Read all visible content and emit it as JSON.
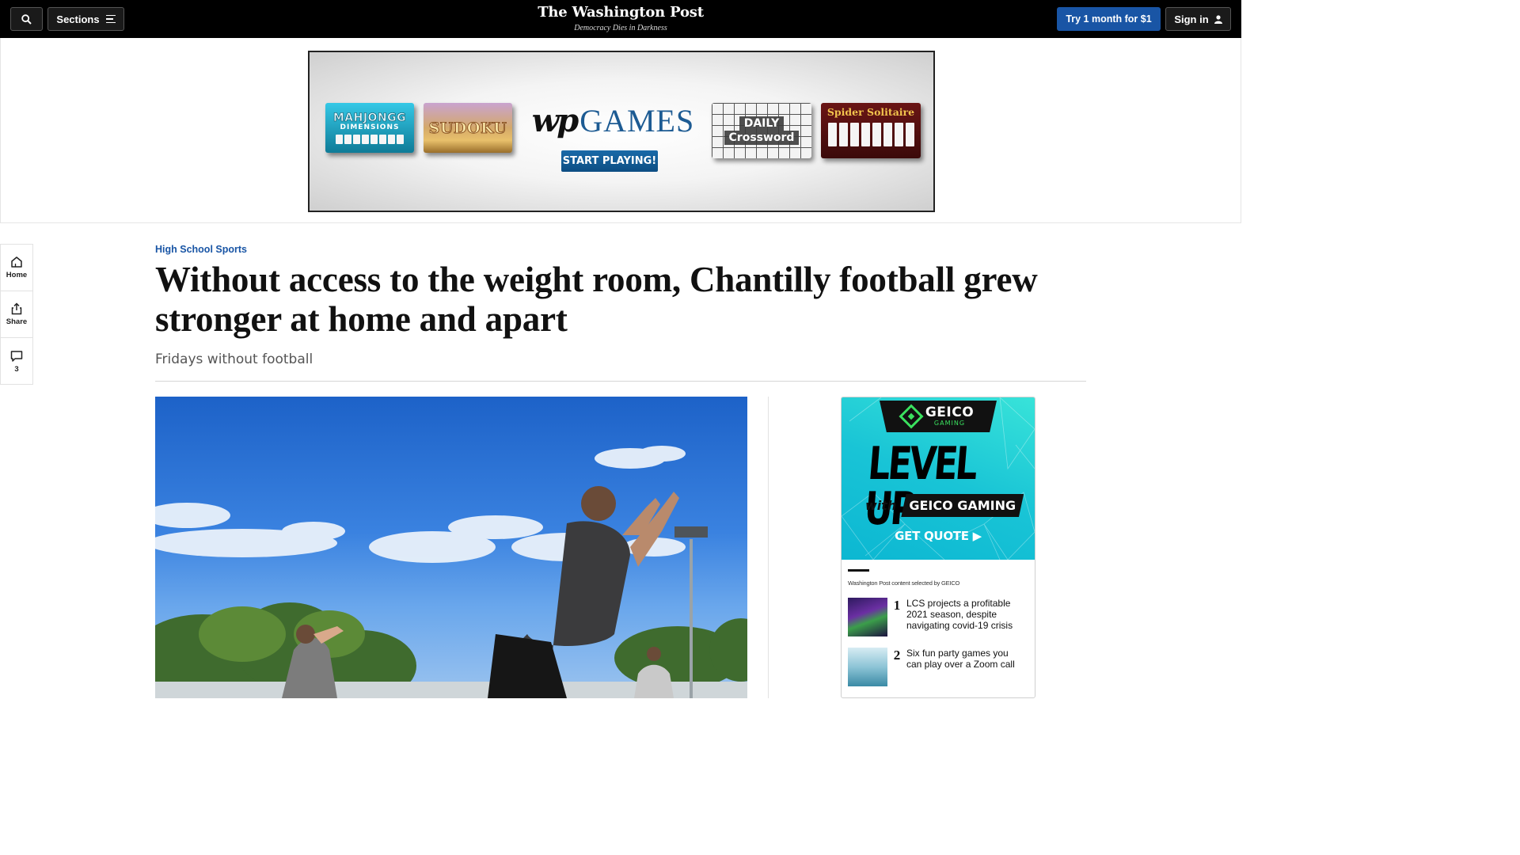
{
  "topnav": {
    "sections_label": "Sections",
    "logo": "The Washington Post",
    "tagline": "Democracy Dies in Darkness",
    "try_label": "Try 1 month for $1",
    "signin_label": "Sign in"
  },
  "ad_banner": {
    "mahjong_line1": "MAHJONGG",
    "mahjong_line2": "DIMENSIONS",
    "sudoku": "SUDOKU",
    "wp_mark": "wp",
    "games": "GAMES",
    "start_label": "START PLAYING!",
    "crossword_line1": "DAILY",
    "crossword_line2": "Crossword",
    "solitaire": "Spider Solitaire"
  },
  "left_rail": {
    "home_label": "Home",
    "share_label": "Share",
    "comment_count": "3"
  },
  "article": {
    "kicker": "High School Sports",
    "headline": "Without access to the weight room, Chantilly football grew stronger at home and apart",
    "dek": "Fridays without football"
  },
  "right_ad": {
    "geico": "GEICO",
    "geico_sub": "GAMING",
    "level_up": "LEVEL UP",
    "with": "with",
    "geico_gaming": "GEICO GAMING",
    "get_quote": "GET QUOTE ▶",
    "sponsor_note": "Washington Post content selected by GEICO",
    "items": [
      {
        "num": "1",
        "title": "LCS projects a profitable 2021 season, despite navigating covid-19 crisis"
      },
      {
        "num": "2",
        "title": "Six fun party games you can play over a Zoom call"
      }
    ]
  }
}
